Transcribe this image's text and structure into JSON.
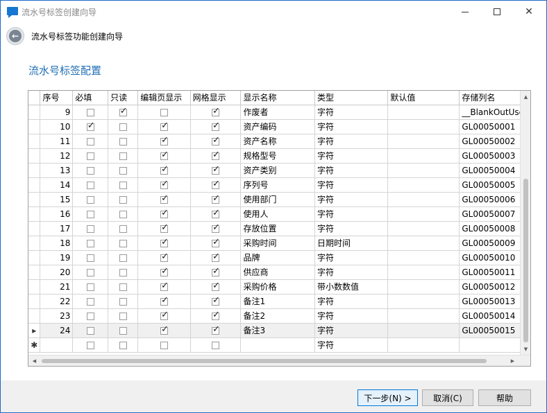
{
  "window": {
    "title": "流水号标签创建向导",
    "controls": [
      "minimize",
      "maximize",
      "close"
    ]
  },
  "nav": {
    "title": "流水号标签功能创建向导"
  },
  "section": {
    "title": "流水号标签配置"
  },
  "grid": {
    "columns": [
      "序号",
      "必填",
      "只读",
      "编辑页显示",
      "网格显示",
      "显示名称",
      "类型",
      "默认值",
      "存储列名"
    ],
    "rows": [
      {
        "no": "9",
        "required": false,
        "readonly": true,
        "edit": false,
        "grid": true,
        "name": "作废者",
        "type": "字符",
        "default": "",
        "column": "__BlankOutUser"
      },
      {
        "no": "10",
        "required": true,
        "readonly": false,
        "edit": true,
        "grid": true,
        "name": "资产编码",
        "type": "字符",
        "default": "",
        "column": "GL00050001"
      },
      {
        "no": "11",
        "required": false,
        "readonly": false,
        "edit": true,
        "grid": true,
        "name": "资产名称",
        "type": "字符",
        "default": "",
        "column": "GL00050002"
      },
      {
        "no": "12",
        "required": false,
        "readonly": false,
        "edit": true,
        "grid": true,
        "name": "规格型号",
        "type": "字符",
        "default": "",
        "column": "GL00050003"
      },
      {
        "no": "13",
        "required": false,
        "readonly": false,
        "edit": true,
        "grid": true,
        "name": "资产类别",
        "type": "字符",
        "default": "",
        "column": "GL00050004"
      },
      {
        "no": "14",
        "required": false,
        "readonly": false,
        "edit": true,
        "grid": true,
        "name": "序列号",
        "type": "字符",
        "default": "",
        "column": "GL00050005"
      },
      {
        "no": "15",
        "required": false,
        "readonly": false,
        "edit": true,
        "grid": true,
        "name": "使用部门",
        "type": "字符",
        "default": "",
        "column": "GL00050006"
      },
      {
        "no": "16",
        "required": false,
        "readonly": false,
        "edit": true,
        "grid": true,
        "name": "使用人",
        "type": "字符",
        "default": "",
        "column": "GL00050007"
      },
      {
        "no": "17",
        "required": false,
        "readonly": false,
        "edit": true,
        "grid": true,
        "name": "存放位置",
        "type": "字符",
        "default": "",
        "column": "GL00050008"
      },
      {
        "no": "18",
        "required": false,
        "readonly": false,
        "edit": true,
        "grid": true,
        "name": "采购时间",
        "type": "日期时间",
        "default": "",
        "column": "GL00050009"
      },
      {
        "no": "19",
        "required": false,
        "readonly": false,
        "edit": true,
        "grid": true,
        "name": "品牌",
        "type": "字符",
        "default": "",
        "column": "GL00050010"
      },
      {
        "no": "20",
        "required": false,
        "readonly": false,
        "edit": true,
        "grid": true,
        "name": "供应商",
        "type": "字符",
        "default": "",
        "column": "GL00050011"
      },
      {
        "no": "21",
        "required": false,
        "readonly": false,
        "edit": true,
        "grid": true,
        "name": "采购价格",
        "type": "带小数数值",
        "default": "",
        "column": "GL00050012"
      },
      {
        "no": "22",
        "required": false,
        "readonly": false,
        "edit": true,
        "grid": true,
        "name": "备注1",
        "type": "字符",
        "default": "",
        "column": "GL00050013"
      },
      {
        "no": "23",
        "required": false,
        "readonly": false,
        "edit": true,
        "grid": true,
        "name": "备注2",
        "type": "字符",
        "default": "",
        "column": "GL00050014"
      },
      {
        "no": "24",
        "required": false,
        "readonly": false,
        "edit": true,
        "grid": true,
        "name": "备注3",
        "type": "字符",
        "default": "",
        "column": "GL00050015",
        "current": true
      },
      {
        "no": "",
        "required": false,
        "readonly": false,
        "edit": false,
        "grid": false,
        "name": "",
        "type": "字符",
        "default": "",
        "column": "",
        "newrow": true
      }
    ]
  },
  "footer": {
    "next_label": "下一步(N) >",
    "cancel_label": "取消(C)",
    "help_label": "帮助"
  },
  "icons": {
    "back": "back-arrow-icon",
    "current_row": "▸",
    "new_row": "✱"
  }
}
